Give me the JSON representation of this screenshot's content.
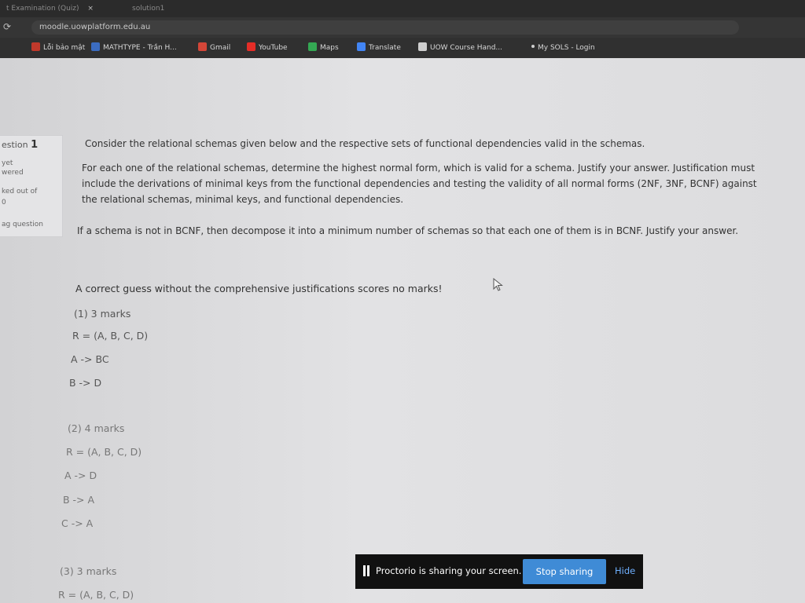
{
  "browser": {
    "tabs": [
      {
        "label": "t Examination (Quiz)",
        "close": "×"
      },
      {
        "label": "solution1"
      }
    ],
    "url": "moodle.uowplatform.edu.au",
    "bookmarks": [
      {
        "label": "Lỗi bảo mật",
        "color": "#c0392b"
      },
      {
        "label": "MATHTYPE - Trần H...",
        "color": "#3b6cc0"
      },
      {
        "label": "Gmail",
        "color": "#d44638"
      },
      {
        "label": "YouTube",
        "color": "#e52d27"
      },
      {
        "label": "Maps",
        "color": "#34a853"
      },
      {
        "label": "Translate",
        "color": "#4285f4"
      },
      {
        "label": "UOW Course Hand...",
        "color": "#cfcfcf"
      },
      {
        "label": "My SOLS - Login",
        "color": "#cfcfcf"
      }
    ]
  },
  "question_info": {
    "number_prefix": "estion",
    "number": "1",
    "status_line1": "yet",
    "status_line2": "wered",
    "marked_out_of": "ked out of",
    "marks": "0",
    "flag": "ag question"
  },
  "question": {
    "intro": "Consider the relational schemas given below and the respective sets of functional dependencies valid in the schemas.",
    "para1": "For each one of the relational schemas, determine the highest normal form, which is valid for a schema. Justify your answer. Justification must include the derivations of minimal keys from the functional dependencies and testing the validity of all normal forms (2NF, 3NF, BCNF) against the relational schemas, minimal keys, and functional dependencies.",
    "para2": "If a schema is not in BCNF, then decompose it into a minimum number of schemas so that each one of them is in BCNF. Justify your answer.",
    "note": "A correct guess without the comprehensive justifications scores no marks!",
    "parts": [
      {
        "title": "(1) 3 marks",
        "schema": "R = (A, B, C, D)",
        "fds": [
          "A -> BC",
          "B -> D"
        ]
      },
      {
        "title": "(2) 4 marks",
        "schema": "R = (A, B, C, D)",
        "fds": [
          "A -> D",
          "B -> A",
          "C -> A"
        ]
      },
      {
        "title": "(3) 3 marks",
        "schema": "R = (A, B, C, D)"
      }
    ]
  },
  "proctorio": {
    "message": "Proctorio is sharing your screen.",
    "stop_label": "Stop sharing",
    "hide_label": "Hide"
  }
}
